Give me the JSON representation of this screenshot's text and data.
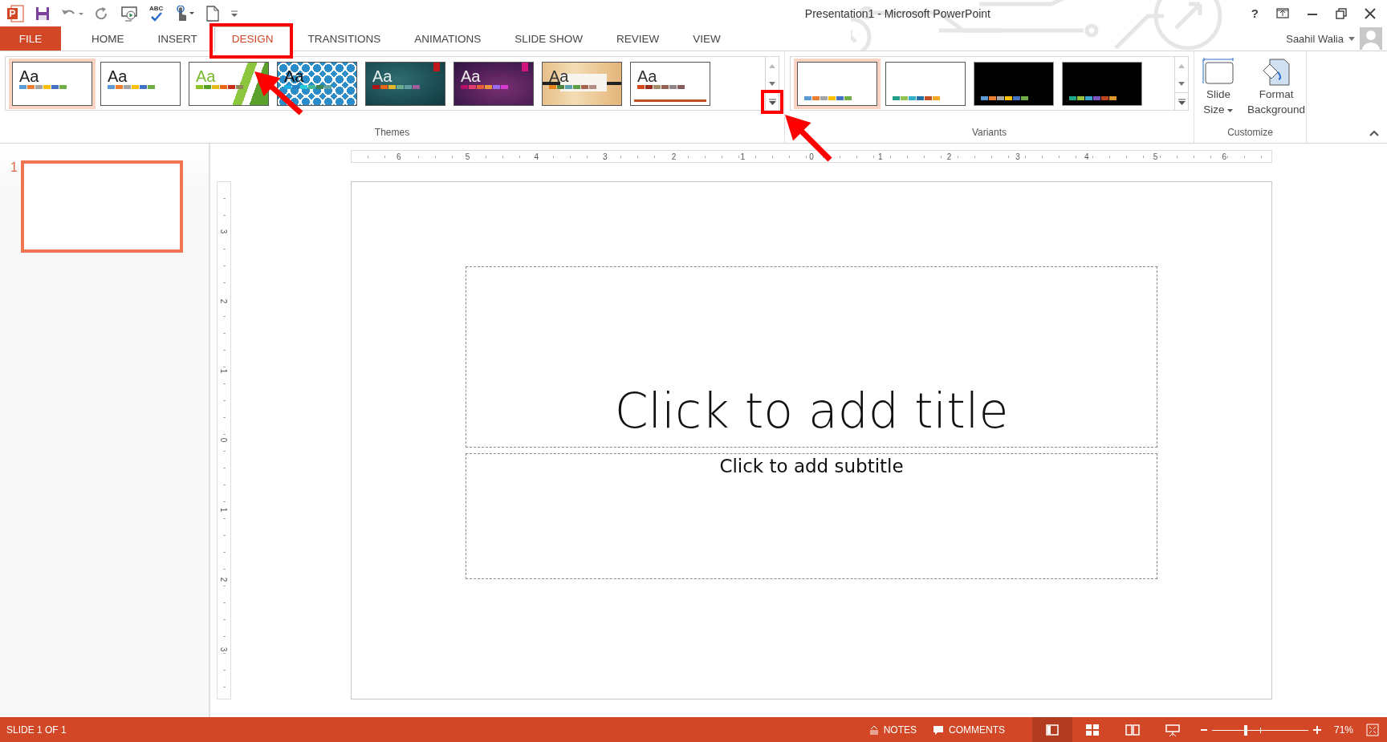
{
  "window": {
    "title": "Presentation1 - Microsoft PowerPoint",
    "help": "?"
  },
  "quick_access": {
    "spelling_label": "ABC"
  },
  "file_tab": {
    "label": "FILE"
  },
  "tabs": [
    {
      "label": "HOME",
      "selected": false,
      "highlighted": false
    },
    {
      "label": "INSERT",
      "selected": false,
      "highlighted": false
    },
    {
      "label": "DESIGN",
      "selected": true,
      "highlighted": true
    },
    {
      "label": "TRANSITIONS",
      "selected": false,
      "highlighted": false
    },
    {
      "label": "ANIMATIONS",
      "selected": false,
      "highlighted": false
    },
    {
      "label": "SLIDE SHOW",
      "selected": false,
      "highlighted": false
    },
    {
      "label": "REVIEW",
      "selected": false,
      "highlighted": false
    },
    {
      "label": "VIEW",
      "selected": false,
      "highlighted": false
    }
  ],
  "user": {
    "name": "Saahil Walia"
  },
  "themes": {
    "label": "Themes",
    "more_button": {
      "highlighted": true
    },
    "items": [
      {
        "sample": "Aa",
        "kind": "plain",
        "selected": true,
        "swatches": [
          {
            "color": "#5b9bd5"
          },
          {
            "color": "#ed7d31"
          },
          {
            "color": "#a5a5a5"
          },
          {
            "color": "#ffc000"
          },
          {
            "color": "#4472c4"
          },
          {
            "color": "#70ad47"
          }
        ]
      },
      {
        "sample": "Aa",
        "kind": "plain",
        "selected": false,
        "swatches": [
          {
            "color": "#5b9bd5"
          },
          {
            "color": "#ed7d31"
          },
          {
            "color": "#a5a5a5"
          },
          {
            "color": "#ffc000"
          },
          {
            "color": "#4472c4"
          },
          {
            "color": "#70ad47"
          }
        ]
      },
      {
        "sample": "Aa",
        "kind": "facet",
        "selected": false,
        "swatches": [
          {
            "color": "#90c226"
          },
          {
            "color": "#54a021"
          },
          {
            "color": "#e6b91e"
          },
          {
            "color": "#e76618"
          },
          {
            "color": "#c42f1a"
          },
          {
            "color": "#918655"
          }
        ]
      },
      {
        "sample": "Aa",
        "kind": "pattern",
        "selected": false,
        "swatches": [
          {
            "color": "#1cade4"
          },
          {
            "color": "#2683c6"
          },
          {
            "color": "#27ced7"
          },
          {
            "color": "#42ba97"
          },
          {
            "color": "#3e8853"
          },
          {
            "color": "#62a39f"
          }
        ]
      },
      {
        "sample": "Aa",
        "kind": "teal",
        "selected": false,
        "swatches": [
          {
            "color": "#b01513"
          },
          {
            "color": "#ea6312"
          },
          {
            "color": "#e6b729"
          },
          {
            "color": "#6aac90"
          },
          {
            "color": "#5f9c9d"
          },
          {
            "color": "#9e5e9b"
          }
        ]
      },
      {
        "sample": "Aa",
        "kind": "purple",
        "selected": false,
        "swatches": [
          {
            "color": "#b31166"
          },
          {
            "color": "#e33d6f"
          },
          {
            "color": "#e45f3c"
          },
          {
            "color": "#e9943a"
          },
          {
            "color": "#9b6bf2"
          },
          {
            "color": "#d53dd0"
          }
        ]
      },
      {
        "sample": "Aa",
        "kind": "wood",
        "selected": false,
        "swatches": [
          {
            "color": "#e48312"
          },
          {
            "color": "#4e8542"
          },
          {
            "color": "#5aa2ae"
          },
          {
            "color": "#5c9e48"
          },
          {
            "color": "#a5644e"
          },
          {
            "color": "#b58b80"
          }
        ]
      },
      {
        "sample": "Aa",
        "kind": "retro",
        "selected": false,
        "swatches": [
          {
            "color": "#d34817"
          },
          {
            "color": "#9b2d1f"
          },
          {
            "color": "#a28e6a"
          },
          {
            "color": "#956251"
          },
          {
            "color": "#918485"
          },
          {
            "color": "#855d5d"
          }
        ]
      }
    ]
  },
  "variants": {
    "label": "Variants",
    "items": [
      {
        "kind": "light",
        "selected": true,
        "swatches": [
          {
            "color": "#5b9bd5"
          },
          {
            "color": "#ed7d31"
          },
          {
            "color": "#a5a5a5"
          },
          {
            "color": "#ffc000"
          },
          {
            "color": "#4472c4"
          },
          {
            "color": "#70ad47"
          }
        ]
      },
      {
        "kind": "light",
        "selected": false,
        "swatches": [
          {
            "color": "#1e9e84"
          },
          {
            "color": "#8fc34f"
          },
          {
            "color": "#2fb0c8"
          },
          {
            "color": "#1f6fa8"
          },
          {
            "color": "#c0501f"
          },
          {
            "color": "#f5a623"
          }
        ]
      },
      {
        "kind": "dark",
        "selected": false,
        "swatches": [
          {
            "color": "#5b9bd5"
          },
          {
            "color": "#ed7d31"
          },
          {
            "color": "#a5a5a5"
          },
          {
            "color": "#ffc000"
          },
          {
            "color": "#4472c4"
          },
          {
            "color": "#70ad47"
          }
        ]
      },
      {
        "kind": "dark",
        "selected": false,
        "swatches": [
          {
            "color": "#1ea88a"
          },
          {
            "color": "#97c23e"
          },
          {
            "color": "#3aa6cf"
          },
          {
            "color": "#7e57c2"
          },
          {
            "color": "#c0441f"
          },
          {
            "color": "#e0962e"
          }
        ]
      }
    ]
  },
  "customize": {
    "label": "Customize",
    "buttons": [
      {
        "kind": "slide-size",
        "lines": [
          "Slide",
          "Size"
        ]
      },
      {
        "kind": "format-background",
        "lines": [
          "Format",
          "Background"
        ]
      }
    ]
  },
  "thumbnails": [
    {
      "number": "1",
      "selected": true
    }
  ],
  "rulers": {
    "horizontal": [
      "6",
      "5",
      "4",
      "3",
      "2",
      "1",
      "0",
      "1",
      "2",
      "3",
      "4",
      "5",
      "6"
    ],
    "vertical": [
      "3",
      "2",
      "1",
      "0",
      "1",
      "2",
      "3"
    ]
  },
  "slide": {
    "title_placeholder": "Click to add title",
    "subtitle_placeholder": "Click to add subtitle"
  },
  "status_bar": {
    "slide_info": "SLIDE 1 OF 1",
    "notes": "NOTES",
    "comments": "COMMENTS",
    "views": [
      {
        "kind": "normal",
        "selected": true
      },
      {
        "kind": "sorter",
        "selected": false
      },
      {
        "kind": "reading",
        "selected": false
      },
      {
        "kind": "slideshow",
        "selected": false
      }
    ],
    "zoom": {
      "level": 0.35,
      "reading": "71%"
    }
  }
}
